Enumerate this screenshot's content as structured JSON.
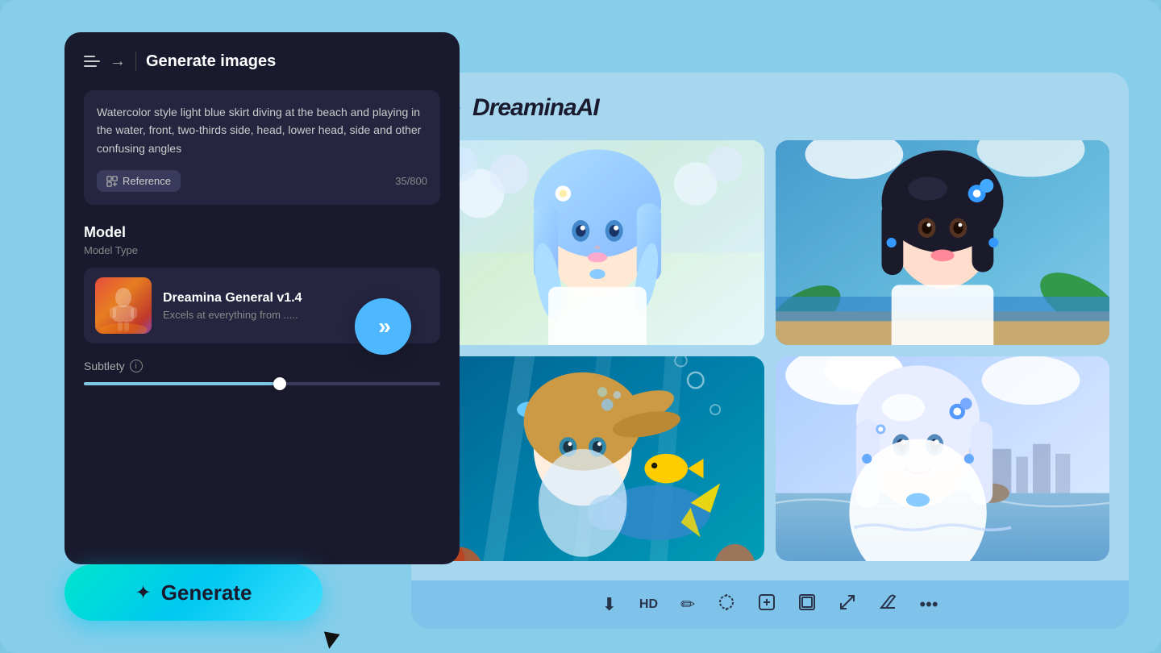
{
  "app": {
    "brand": "DreaminaAI",
    "background_color": "#87ceeb"
  },
  "left_panel": {
    "title": "Generate images",
    "prompt": {
      "text": "Watercolor style light blue skirt diving at the beach and playing in the water, front, two-thirds side, head, lower head, side and other confusing angles",
      "char_count": "35/800",
      "reference_button_label": "Reference"
    },
    "model": {
      "section_label": "Model",
      "type_label": "Model Type",
      "name": "Dreamina General v1.4",
      "description": "Excels at everything from .....",
      "thumbnail_emoji": "🧑‍🚀"
    },
    "subtlety": {
      "label": "Subtlety",
      "value": 55
    }
  },
  "generate_button": {
    "label": "Generate",
    "icon": "✦"
  },
  "right_panel": {
    "toolbar": {
      "download_icon": "⬇",
      "hd_label": "HD",
      "wand_icon": "✦",
      "magic_icon": "⊙",
      "plus_square_icon": "⊞",
      "frame_icon": "⬜",
      "resize_icon": "⤡",
      "eraser_icon": "⌫",
      "more_icon": "•••"
    },
    "images": [
      {
        "id": 1,
        "theme": "blue-hair-girl-flowers"
      },
      {
        "id": 2,
        "theme": "dark-hair-girl-beach"
      },
      {
        "id": 3,
        "theme": "underwater-scene"
      },
      {
        "id": 4,
        "theme": "white-hair-girl-sea"
      }
    ]
  }
}
